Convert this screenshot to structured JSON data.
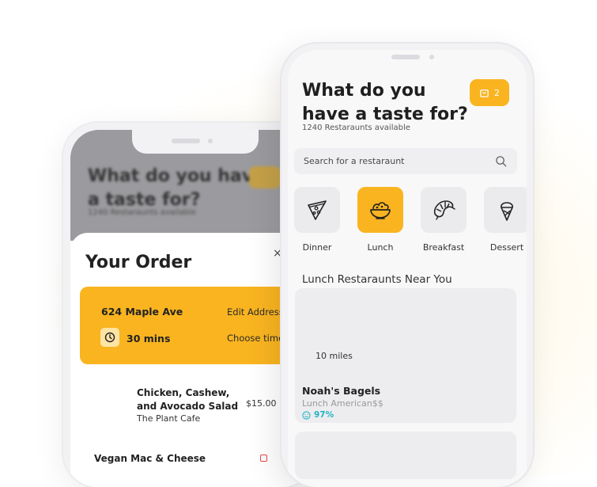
{
  "back_phone": {
    "header_title": "What do you have a taste for?",
    "header_subtitle": "1240 Restaraunts available",
    "order_title": "Your Order",
    "close_label": "×",
    "address": "624 Maple Ave",
    "edit_address": "Edit Address",
    "delivery_time": "30 mins",
    "choose_time": "Choose time",
    "item_name": "Chicken, Cashew, and Avocado Salad",
    "item_place": "The Plant Cafe",
    "item_price": "$15.00",
    "item2_name": "Vegan Mac & Cheese"
  },
  "front_phone": {
    "title": "What do you have a taste for?",
    "subtitle": "1240 Restaraunts available",
    "cart_count": "2",
    "search_placeholder": "Search for a restaraunt",
    "categories": [
      {
        "label": "Dinner",
        "icon": "pizza-icon"
      },
      {
        "label": "Lunch",
        "icon": "salad-bowl-icon",
        "active": true
      },
      {
        "label": "Breakfast",
        "icon": "croissant-icon"
      },
      {
        "label": "Dessert",
        "icon": "ice-cream-icon"
      }
    ],
    "section_title": "Lunch Restaraunts Near You",
    "restaurant": {
      "distance": "10 miles",
      "name": "Noah's Bagels",
      "tags": "Lunch American$$",
      "rating": "97%"
    }
  },
  "colors": {
    "accent": "#f9b420",
    "rating": "#24b3c4"
  }
}
